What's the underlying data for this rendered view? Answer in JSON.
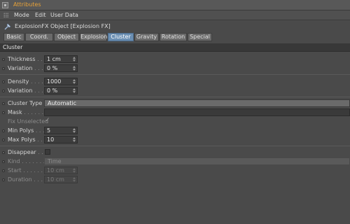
{
  "window": {
    "title": "Attributes"
  },
  "menubar": {
    "items": [
      "Mode",
      "Edit",
      "User Data"
    ]
  },
  "object": {
    "title": "ExplosionFX Object [Explosion FX]"
  },
  "tabs": [
    "Basic",
    "Coord.",
    "Object",
    "Explosion",
    "Cluster",
    "Gravity",
    "Rotation",
    "Special"
  ],
  "active_tab": "Cluster",
  "section": {
    "title": "Cluster"
  },
  "params": {
    "thickness": {
      "label": "Thickness",
      "lead": " . . . . ",
      "value": "1 cm"
    },
    "variation1": {
      "label": "Variation",
      "lead": " . . . . ",
      "value": "0 %"
    },
    "density": {
      "label": "Density",
      "lead": " . . . . . ",
      "value": "1000"
    },
    "variation2": {
      "label": "Variation",
      "lead": " . . . . ",
      "value": "0 %"
    },
    "cluster_type": {
      "label": "Cluster Type",
      "lead": " . ",
      "value": "Automatic"
    },
    "mask": {
      "label": "Mask",
      "lead": " . . . . . . . ",
      "value": ""
    },
    "fix_unselected": {
      "label": "Fix Unselected",
      "checked": true
    },
    "min_polys": {
      "label": "Min Polys",
      "lead": " . . . . ",
      "value": "5"
    },
    "max_polys": {
      "label": "Max Polys",
      "lead": " . . . . ",
      "value": "10"
    },
    "disappear": {
      "label": "Disappear",
      "lead": " . . . . ",
      "checked": false
    },
    "kind": {
      "label": "Kind",
      "lead": " . . . . . . . . ",
      "value": "Time"
    },
    "start": {
      "label": "Start",
      "lead": " . . . . . . . . ",
      "value": "10 cm"
    },
    "duration": {
      "label": "Duration",
      "lead": " . . . . . . ",
      "value": "10 cm"
    }
  },
  "colors": {
    "title_accent": "#e8a238",
    "active_tab": "#6b8fb3",
    "background": "#4a4a4a"
  },
  "icons": {
    "window": "window-icon",
    "object": "explosion-fx-object-icon",
    "checkmark": "checkmark-icon"
  }
}
